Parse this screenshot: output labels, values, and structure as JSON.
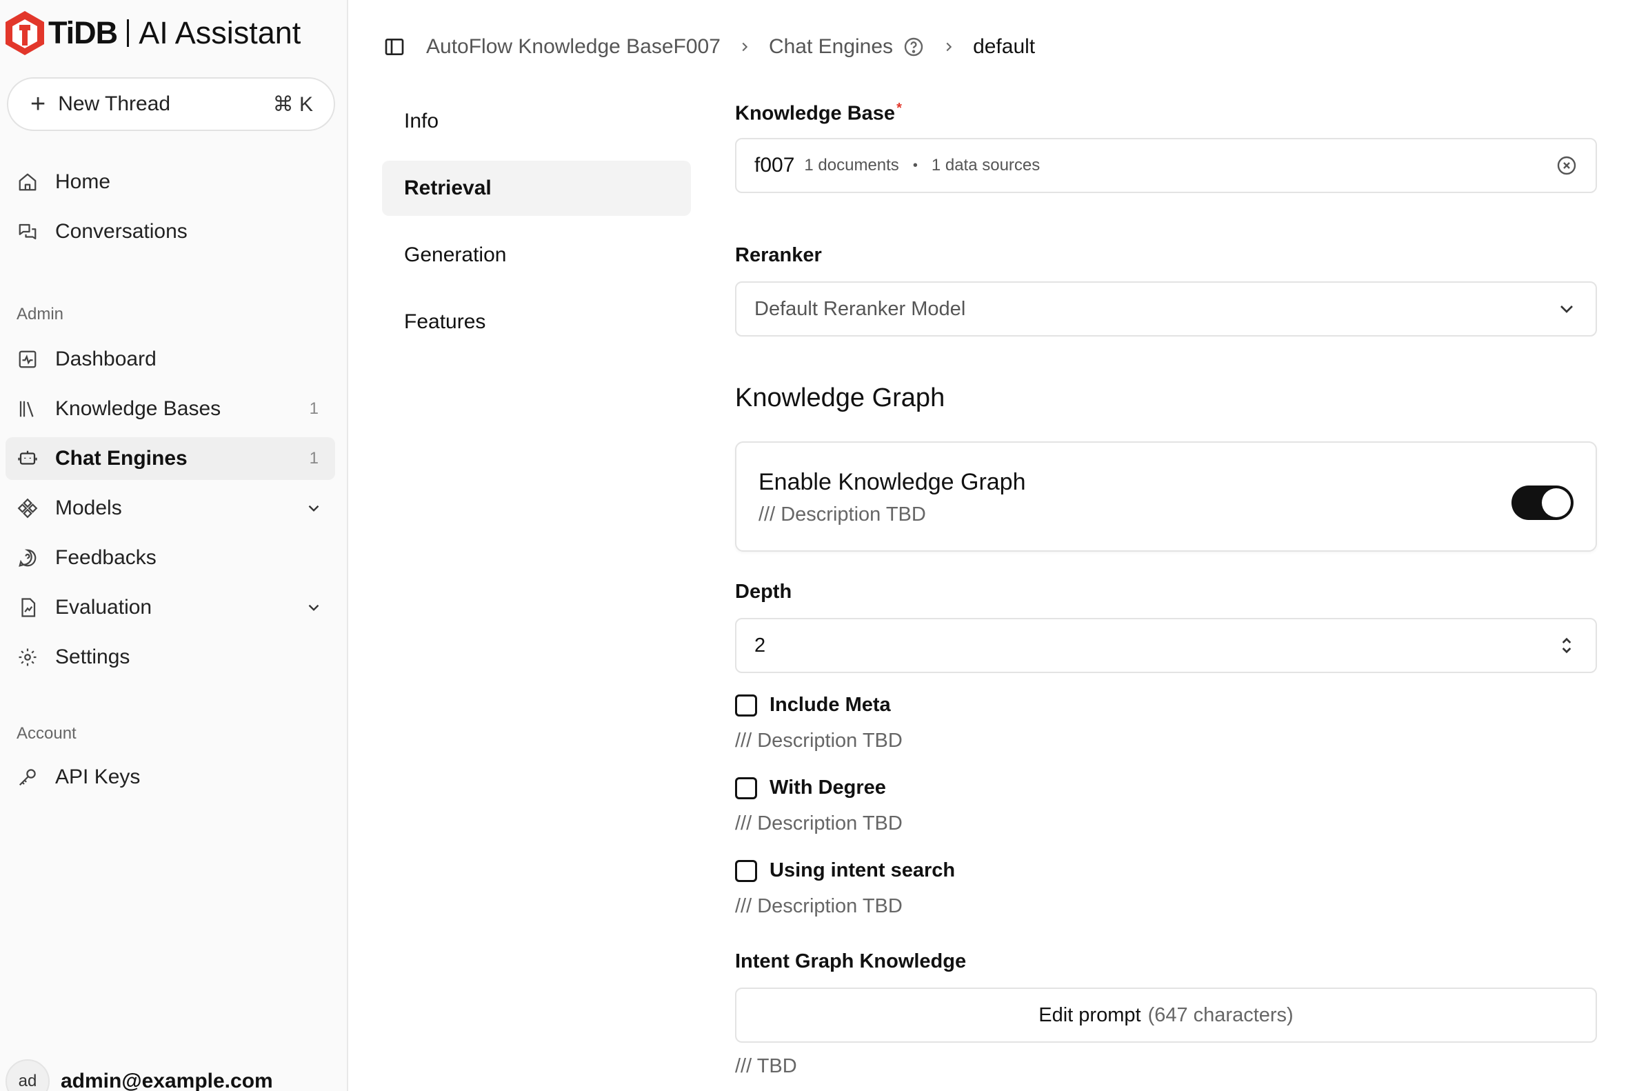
{
  "brand": {
    "name": "TiDB",
    "product": "AI Assistant",
    "accent": "#e2372b"
  },
  "sidebar": {
    "new_thread": {
      "label": "New Thread",
      "shortcut": "⌘ K"
    },
    "items": [
      {
        "label": "Home",
        "icon": "home-icon"
      },
      {
        "label": "Conversations",
        "icon": "conversations-icon"
      }
    ],
    "admin_label": "Admin",
    "admin_items": [
      {
        "label": "Dashboard",
        "icon": "dashboard-icon"
      },
      {
        "label": "Knowledge Bases",
        "icon": "library-icon",
        "count": "1"
      },
      {
        "label": "Chat Engines",
        "icon": "bot-icon",
        "count": "1"
      },
      {
        "label": "Models",
        "icon": "models-icon"
      },
      {
        "label": "Feedbacks",
        "icon": "feedback-icon"
      },
      {
        "label": "Evaluation",
        "icon": "evaluation-icon"
      },
      {
        "label": "Settings",
        "icon": "gear-icon"
      }
    ],
    "account_label": "Account",
    "account_items": [
      {
        "label": "API Keys",
        "icon": "key-icon"
      }
    ],
    "user": {
      "avatar": "ad",
      "email": "admin@example.com"
    }
  },
  "breadcrumb": {
    "items": [
      "AutoFlow Knowledge BaseF007",
      "Chat Engines",
      "default"
    ]
  },
  "subnav": {
    "items": [
      "Info",
      "Retrieval",
      "Generation",
      "Features"
    ],
    "active": "Retrieval"
  },
  "form": {
    "knowledge_base": {
      "label": "Knowledge Base",
      "name": "f007",
      "documents": "1 documents",
      "sources": "1 data sources"
    },
    "reranker": {
      "label": "Reranker",
      "placeholder": "Default Reranker Model"
    },
    "kg_heading": "Knowledge Graph",
    "enable_kg": {
      "title": "Enable Knowledge Graph",
      "description": "/// Description TBD",
      "enabled": true
    },
    "depth": {
      "label": "Depth",
      "value": "2"
    },
    "include_meta": {
      "label": "Include Meta",
      "description": "/// Description TBD",
      "checked": false
    },
    "with_degree": {
      "label": "With Degree",
      "description": "/// Description TBD",
      "checked": false
    },
    "intent_search": {
      "label": "Using intent search",
      "description": "/// Description TBD",
      "checked": false
    },
    "intent_graph": {
      "label": "Intent Graph Knowledge",
      "button": "Edit prompt",
      "chars": "(647 characters)",
      "description": "/// TBD"
    }
  }
}
